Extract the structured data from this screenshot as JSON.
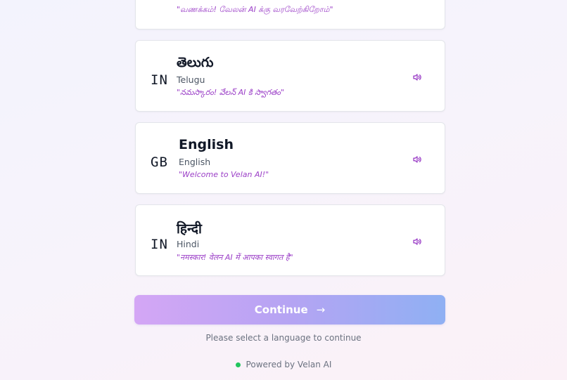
{
  "languages": [
    {
      "code": "",
      "native": "",
      "english": "",
      "greeting": "\"வணக்கம்! வேலன் AI க்கு வரவேற்கிறோம்\""
    },
    {
      "code": "IN",
      "native": "తెలుగు",
      "english": "Telugu",
      "greeting": "\"నమస్కారం! వేలన్ AI కి స్వాగతం\""
    },
    {
      "code": "GB",
      "native": "English",
      "english": "English",
      "greeting": "\"Welcome to Velan AI!\""
    },
    {
      "code": "IN",
      "native": "हिन्दी",
      "english": "Hindi",
      "greeting": "\"नमस्कार! वेलन AI में आपका स्वागत है\""
    }
  ],
  "continue_button": {
    "label": "Continue",
    "arrow": "→"
  },
  "hint": "Please select a language to continue",
  "footer": {
    "powered_by": "Powered by Velan AI",
    "status_color": "#22c55e"
  },
  "colors": {
    "accent": "#9b3fc7",
    "button_gradient_start": "#d4a6f5",
    "button_gradient_end": "#8fb0f3"
  },
  "icons": {
    "speaker": "speaker-volume-icon",
    "arrow": "arrow-right-icon",
    "status": "status-dot-icon"
  }
}
